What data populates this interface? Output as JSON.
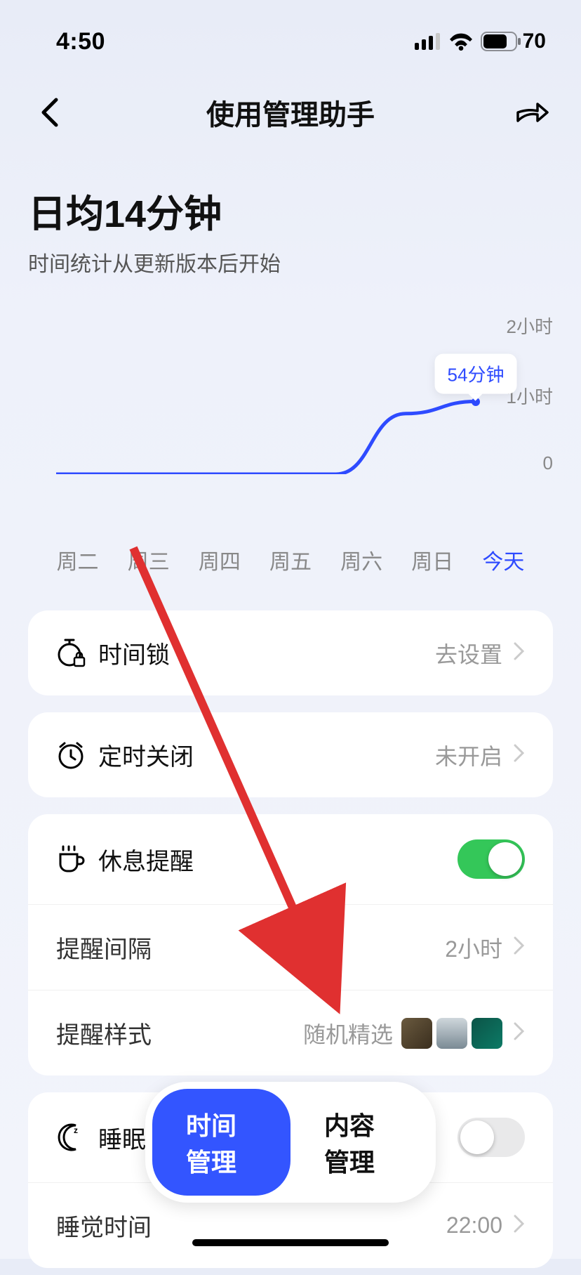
{
  "status": {
    "time": "4:50",
    "battery": "70"
  },
  "nav": {
    "title": "使用管理助手"
  },
  "summary": {
    "title": "日均14分钟",
    "subtitle": "时间统计从更新版本后开始"
  },
  "chart_data": {
    "type": "line",
    "categories": [
      "周二",
      "周三",
      "周四",
      "周五",
      "周六",
      "周日",
      "今天"
    ],
    "values": [
      0,
      0,
      0,
      0,
      0,
      45,
      54
    ],
    "ylabel_ticks": [
      "2小时",
      "1小时",
      "0"
    ],
    "ylim": [
      0,
      120
    ],
    "highlight": {
      "index": 6,
      "label": "54分钟"
    },
    "active_category_index": 6
  },
  "settings": {
    "time_lock": {
      "label": "时间锁",
      "value": "去设置"
    },
    "scheduled_off": {
      "label": "定时关闭",
      "value": "未开启"
    },
    "rest_reminder": {
      "label": "休息提醒",
      "on": true
    },
    "interval": {
      "label": "提醒间隔",
      "value": "2小时"
    },
    "style": {
      "label": "提醒样式",
      "value": "随机精选"
    },
    "sleep_reminder": {
      "label": "睡眠提醒",
      "on": false
    },
    "sleep_time": {
      "label": "睡觉时间",
      "value": "22:00"
    }
  },
  "tabs": {
    "active": "时间管理",
    "inactive": "内容管理"
  }
}
